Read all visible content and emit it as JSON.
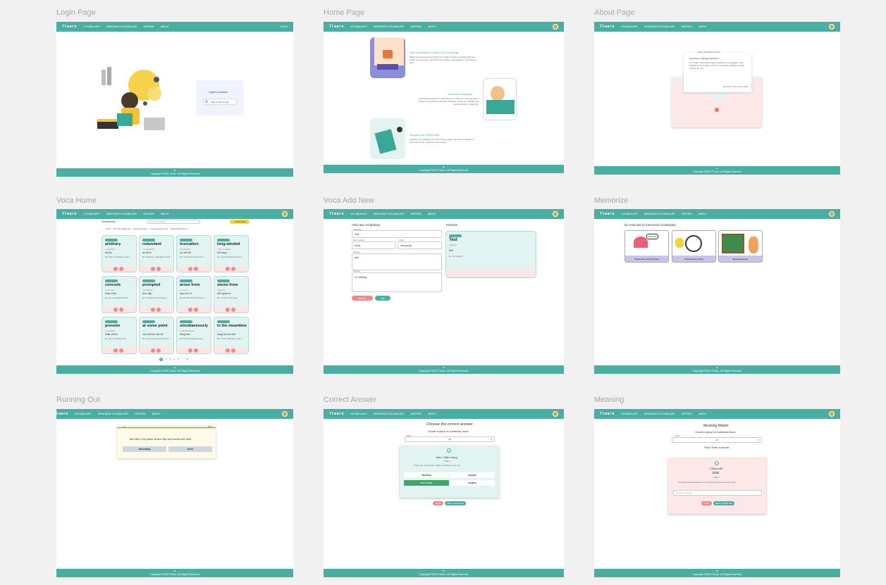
{
  "frames": {
    "login": "Login Page",
    "home": "Home Page",
    "about": "About Page",
    "voca_home": "Voca Home",
    "voca_add": "Voca Add New",
    "memorize": "Memorize",
    "running_out": "Running Out",
    "correct_answer": "Correct Answer",
    "meaning": "Meaning"
  },
  "nav": {
    "logo": "Tlearn",
    "vocabulary": "VOCABULARY",
    "memorize": "MEMORIZE VOCABULARY",
    "writing": "WRITING",
    "about": "ABOUT",
    "login": "LOGIN"
  },
  "footer": "Copyright ©2024 Tlearn. All Rights Reserved",
  "login": {
    "prompt": "Login to continue",
    "google_button": "Sign in with Google"
  },
  "home": {
    "s1_title": "Store Vocabulary to Expand Your Knowledge",
    "s1_text": "Build your personal word bank! Our platform helps you easily add new words you encounter, whether from reading, conversation, or anywhere else.",
    "s2_title": "Memorize Vocabulary",
    "s2_text": "Learning shouldn't be boring! Put your memory to the test with a variety of interactive exercises designed to help you solidify new words and their meanings.",
    "s3_title": "Discover Your Writing Skills",
    "s3_text": "Capture your thoughts and hone writing skills. Use new vocabulary in your own words, sentences and essays."
  },
  "about": {
    "greeting": "Greetings, Language Explorers!",
    "letter_title": "From the Tlearn's Heart",
    "body": "I'm Tlearn, a developer with a passion for languages. This website is my creation, and I'm constantly working to make it better for you.",
    "sign": "Sincerely, The Lorem Team"
  },
  "voca_home": {
    "title": "Vocabulary",
    "search_placeholder": "Search vocabulary",
    "add_button": "+ ADD NEW",
    "filters": [
      "All 25",
      "My Intermediate 10",
      "Family Friends 4",
      "Intermediate 1-6 12",
      "Intermediate 10-14 7",
      "Intermediate 15-18 5"
    ],
    "cards": [
      {
        "word": "arbitrary",
        "phon": "/ ˈɑːbɪtrəri /",
        "mean": "bất kỳ",
        "ex": "Ex: Pick an arbitrary value."
      },
      {
        "word": "redundant",
        "phon": "/ rɪˈdʌndənt /",
        "mean": "dư thừa",
        "ex": "Ex: Remove redundant words."
      },
      {
        "word": "truncation",
        "phon": "/ trʌŋˈkeɪʃn /",
        "mean": "sự cắt bớt",
        "ex": "Ex: Truncation of the text."
      },
      {
        "word": "long-winded",
        "phon": "/ ˌlɒŋ ˈwɪndɪd /",
        "mean": "dài dòng",
        "ex": "Ex: A long-winded speech."
      },
      {
        "word": "concede",
        "phon": "/ kənˈsiːd /",
        "mean": "thừa nhận",
        "ex": "Ex: He conceded defeat."
      },
      {
        "word": "prompted",
        "phon": "/ prɒmptɪd /",
        "mean": "thúc đẩy",
        "ex": "Ex: Prompted by curiosity."
      },
      {
        "word": "arose from",
        "phon": "/ əˈrəʊz /",
        "mean": "nảy sinh từ",
        "ex": "Ex: Problems arose from it."
      },
      {
        "word": "stems from",
        "phon": "/ stemz /",
        "mean": "bắt nguồn từ",
        "ex": "Ex: It stems from fear."
      },
      {
        "word": "provoke",
        "phon": "/ prəˈvəʊk /",
        "mean": "khiêu khích",
        "ex": "Ex: Don't provoke him."
      },
      {
        "word": "at some point",
        "phon": "/ ... /",
        "mean": "vào một lúc nào đó",
        "ex": "Ex: At some point we'll meet."
      },
      {
        "word": "simultaneously",
        "phon": "/ ˌsɪmlˈteɪniəsli /",
        "mean": "đồng thời",
        "ex": "Ex: Done simultaneously."
      },
      {
        "word": "in the meantime",
        "phon": "/ ... /",
        "mean": "trong khi chờ đợi",
        "ex": "Ex: In the meantime, wait."
      }
    ],
    "pagination": [
      "1",
      "2",
      "3",
      "4",
      "5",
      "...",
      "12",
      "›"
    ]
  },
  "voca_add": {
    "title": "Add new vocabulary",
    "vocab_label": "Vocabulary",
    "vocab_value": "Test",
    "pos_label": "Part of speech",
    "pos_value": "Noun",
    "group_label": "Group",
    "group_value": "new group",
    "meaning_label": "Meaning",
    "meaning_value": "test",
    "example_label": "Example",
    "example_value": "I'm Testing!",
    "cancel": "CANCEL",
    "add": "ADD",
    "preview_title": "Preview",
    "preview_word": "Test",
    "preview_phon": "/ Noun /",
    "preview_mean": "test",
    "preview_ex": "Ex: I'm testing!"
  },
  "memorize": {
    "title": "Do exercise to memorize vocabulary",
    "options": [
      "Choose the correct answer",
      "Running out of time",
      "Meaning master"
    ],
    "bubble": "Pizza ok!"
  },
  "running_out": {
    "progress_left": "1",
    "progress_right": "5 / 5",
    "question": "Bờ biển / the place where the sea meets the land",
    "option_a": "fascinating",
    "option_b": "shore"
  },
  "correct_answer": {
    "title": "Choose the correct answer",
    "group_prompt": "Choose a group for vocabulary focus:",
    "group_label": "Group",
    "group_value": "All",
    "word": "Đau / Viêm họng",
    "phon": "/ Noun /",
    "example": "I have got sore throat, maybe I drink too much ice",
    "options": [
      "literature",
      "opaque",
      "sore throat",
      "surgery"
    ],
    "skip": "SKIP",
    "next": "NEXT QUESTION"
  },
  "meaning": {
    "title": "Meaning Master",
    "group_prompt": "Choose a group for vocabulary focus:",
    "group_label": "Group",
    "group_value": "All",
    "hint": "Press 'Enter' to answer",
    "vi": "Chớp mắt",
    "word": "blink",
    "phon": "/ Verb /",
    "example": "She blinks several times to try and get the dust out of her eye",
    "input_placeholder": "Answer meaning",
    "skip": "SKIP",
    "next": "NEXT QUESTION"
  }
}
